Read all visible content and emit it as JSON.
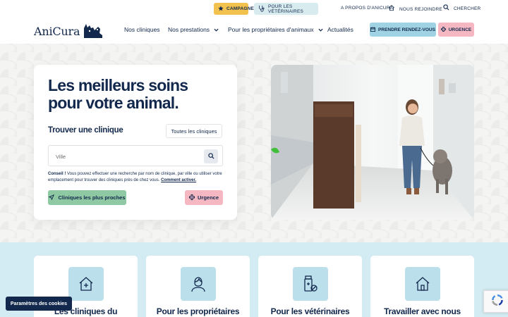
{
  "utility": {
    "campaign_label": "CAMPAGNE",
    "vets_label": "POUR LES VÉTÉRINAIRES",
    "about_label": "A PROPOS D'ANICURA",
    "join_label": "NOUS REJOINDRE",
    "search_label": "CHERCHER"
  },
  "header": {
    "logo_text": "AniCura",
    "nav": [
      {
        "label": "Nos cliniques",
        "dropdown": false
      },
      {
        "label": "Nos prestations",
        "dropdown": true
      },
      {
        "label": "Pour les propriétaires d'animaux",
        "dropdown": true
      },
      {
        "label": "Actualités",
        "dropdown": false
      }
    ],
    "appointment_label": "PRENDRE RENDEZ-VOUS",
    "emergency_label": "URGENCE"
  },
  "hero": {
    "title": "Les meilleurs soins pour votre animal.",
    "find_label": "Trouver une clinique",
    "all_clinics_label": "Toutes les cliniques",
    "search_placeholder": "Ville",
    "tip_bold": "Conseil !",
    "tip_text": " Vous pouvez effectuer une recherche par nom de clinique, par ville ou utiliser votre emplacement pour trouver des cliniques près de chez vous.",
    "tip_link": "Comment activer.",
    "nearest_label": "Cliniques les plus proches",
    "emergency_label": "Urgence"
  },
  "features": [
    {
      "title": "Les cliniques du",
      "icon": "clinic-house-icon"
    },
    {
      "title": "Pour les propriétaires",
      "icon": "owner-person-icon"
    },
    {
      "title": "Pour les vétérinaires",
      "icon": "vet-medicine-icon"
    },
    {
      "title": "Travailler avec nous",
      "icon": "work-house-icon"
    }
  ],
  "cookie_label": "Paramètres des cookies",
  "colors": {
    "navy": "#12284c",
    "campaign": "#f2c14e",
    "appointment": "#9fd3e3",
    "emergency": "#f5b8c3",
    "green": "#8fc9a3",
    "feature_bg": "#d3ebf2"
  }
}
